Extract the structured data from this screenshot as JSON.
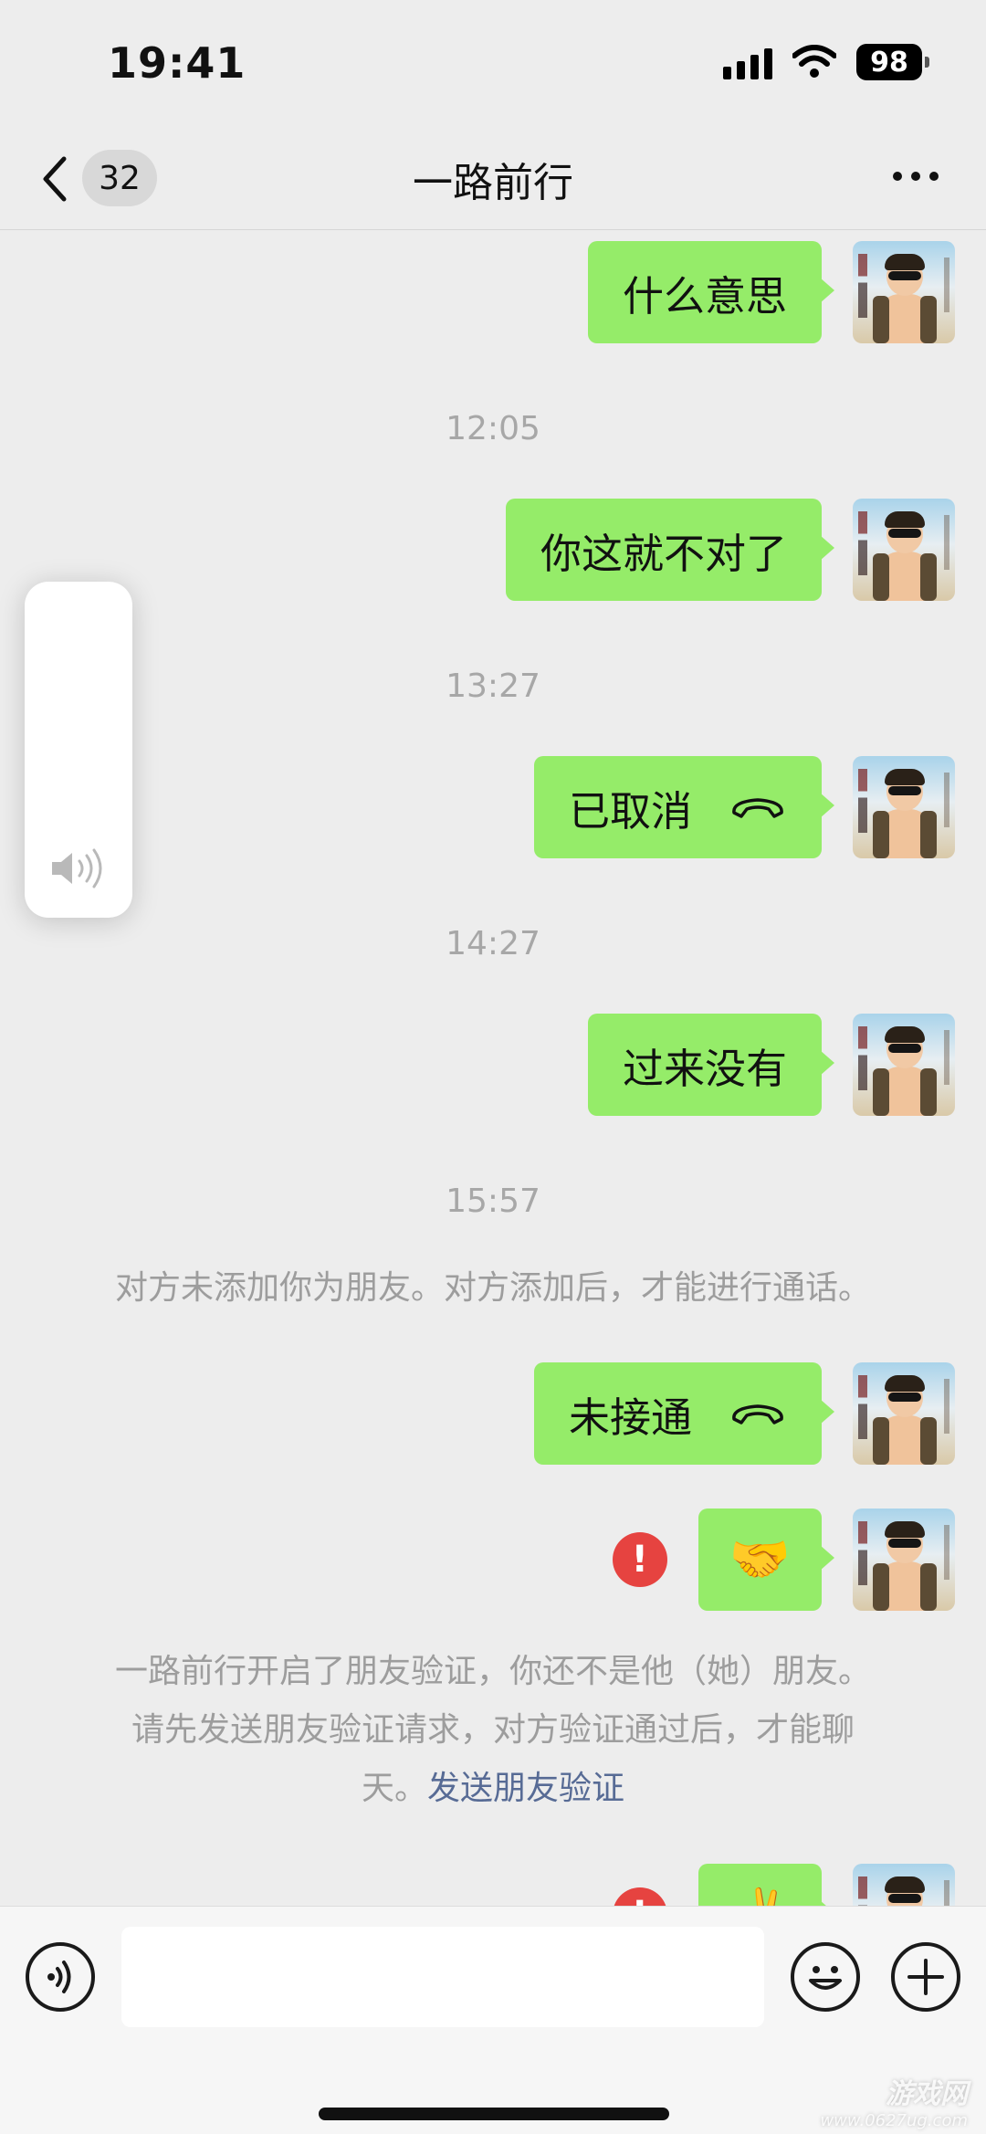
{
  "status_bar": {
    "time": "19:41",
    "battery": "98"
  },
  "nav": {
    "unread_count": "32",
    "title": "一路前行"
  },
  "messages": [
    {
      "text": "什么意思"
    },
    {
      "timestamp": "12:05"
    },
    {
      "text": "你这就不对了"
    },
    {
      "timestamp": "13:27"
    },
    {
      "text": "已取消"
    },
    {
      "timestamp": "14:27"
    },
    {
      "text": "过来没有"
    },
    {
      "timestamp": "15:57"
    },
    {
      "system": "对方未添加你为朋友。对方添加后，才能进行通话。"
    },
    {
      "text": "未接通"
    },
    {
      "sticker": "🤝",
      "error": "!"
    },
    {
      "system_line1": "一路前行开启了朋友验证，你还不是他（她）朋友。",
      "system_line2": "请先发送朋友验证请求，对方验证通过后，才能聊",
      "system_line3": "天。",
      "link": "发送朋友验证"
    },
    {
      "sticker": "✌️",
      "error": "!"
    }
  ],
  "input": {
    "placeholder": ""
  },
  "watermark": {
    "title": "游戏网",
    "sub": "www.0627ug.com"
  },
  "icons": [
    "back-chevron-icon",
    "more-icon",
    "call-icon",
    "error-icon",
    "speaker-icon",
    "voice-icon",
    "emoji-icon",
    "plus-icon"
  ],
  "colors": {
    "bubble": "#95ec69",
    "background": "#ededed",
    "link": "#576b95",
    "error": "#e64340"
  }
}
